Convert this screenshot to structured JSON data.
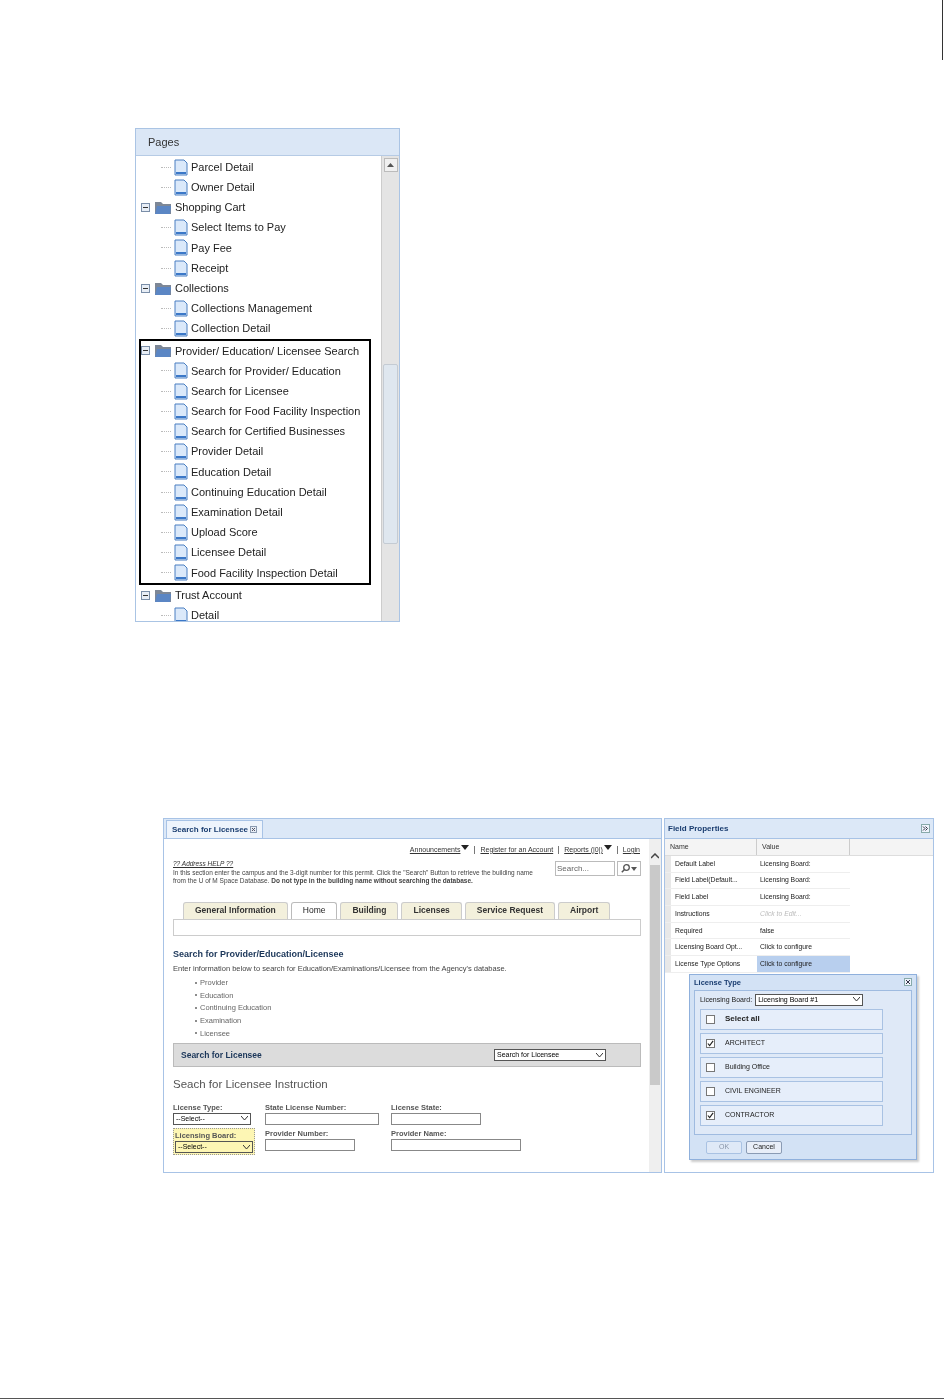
{
  "pages_panel": {
    "title": "Pages",
    "tree": [
      {
        "kind": "page",
        "label": "Parcel Detail"
      },
      {
        "kind": "page",
        "label": "Owner Detail"
      },
      {
        "kind": "folder",
        "label": "Shopping Cart",
        "expanded": true,
        "outlined": false,
        "children": [
          {
            "kind": "page",
            "label": "Select Items to Pay"
          },
          {
            "kind": "page",
            "label": "Pay Fee"
          },
          {
            "kind": "page",
            "label": "Receipt"
          }
        ]
      },
      {
        "kind": "folder",
        "label": "Collections",
        "expanded": true,
        "outlined": false,
        "children": [
          {
            "kind": "page",
            "label": "Collections Management"
          },
          {
            "kind": "page",
            "label": "Collection Detail"
          }
        ]
      },
      {
        "kind": "folder",
        "label": "Provider/ Education/ Licensee Search",
        "expanded": true,
        "outlined": true,
        "children": [
          {
            "kind": "page",
            "label": "Search for Provider/ Education"
          },
          {
            "kind": "page",
            "label": "Search for Licensee"
          },
          {
            "kind": "page",
            "label": "Search for Food Facility Inspection"
          },
          {
            "kind": "page",
            "label": "Search for Certified Businesses"
          },
          {
            "kind": "page",
            "label": "Provider Detail"
          },
          {
            "kind": "page",
            "label": "Education Detail"
          },
          {
            "kind": "page",
            "label": "Continuing Education Detail"
          },
          {
            "kind": "page",
            "label": "Examination Detail"
          },
          {
            "kind": "page",
            "label": "Upload Score"
          },
          {
            "kind": "page",
            "label": "Licensee Detail"
          },
          {
            "kind": "page",
            "label": "Food Facility Inspection Detail"
          }
        ]
      },
      {
        "kind": "folder",
        "label": "Trust Account",
        "expanded": true,
        "outlined": false,
        "children": [
          {
            "kind": "page",
            "label": "Detail"
          }
        ]
      }
    ]
  },
  "editor": {
    "tab": {
      "label": "Search for Licensee"
    },
    "top_links": [
      {
        "label": "Announcements",
        "kind": "menu"
      },
      {
        "label": "Register for an Account",
        "kind": "link"
      },
      {
        "label": "Reports (|0|)",
        "kind": "menu"
      },
      {
        "label": "Login",
        "kind": "link"
      }
    ],
    "help_title": "?? Address HELP ??",
    "help_text": "In this section enter the campus and the 3-digit number for this permit.  Click the \"Search\" Button to retrieve the building name from the U of M Space Database.  **Do not type in the building name without searching the database.**",
    "search": {
      "placeholder": "Search..."
    },
    "nav_tabs": [
      {
        "label": "General Information",
        "selected": false
      },
      {
        "label": "Home",
        "selected": true
      },
      {
        "label": "Building",
        "selected": false
      },
      {
        "label": "Licenses",
        "selected": false
      },
      {
        "label": "Service Request",
        "selected": false
      },
      {
        "label": "Airport",
        "selected": false
      }
    ],
    "heading": "Search for Provider/Education/Licensee",
    "intro": "Enter information below to search for Education/Examinations/Licensee from the Agency's database.",
    "bullets": [
      "Provider",
      "Education",
      "Continuing Education",
      "Examination",
      "Licensee"
    ],
    "section": {
      "title": "Search for Licensee",
      "select": "Search for Licensee"
    },
    "instruction": "Seach for Licensee Instruction",
    "fields": [
      {
        "label": "License Type:",
        "kind": "select",
        "value": "--Select--",
        "highlighted": false
      },
      {
        "label": "State License Number:",
        "kind": "text",
        "highlighted": false
      },
      {
        "label": "License State:",
        "kind": "text",
        "highlighted": false
      },
      {
        "label": "Licensing Board:",
        "kind": "select",
        "value": "--Select--",
        "highlighted": true
      },
      {
        "label": "Provider Number:",
        "kind": "text",
        "highlighted": false
      },
      {
        "label": "Provider Name:",
        "kind": "text",
        "highlighted": false
      }
    ]
  },
  "field_properties": {
    "title": "Field Properties",
    "columns": [
      "Name",
      "Value"
    ],
    "rows": [
      {
        "name": "Default Label",
        "value": "Licensing Board:",
        "placeholder": false,
        "selected": false
      },
      {
        "name": "Field Label(Default...",
        "value": "Licensing Board:",
        "placeholder": false,
        "selected": false
      },
      {
        "name": "Field Label",
        "value": "Licensing Board:",
        "placeholder": false,
        "selected": false
      },
      {
        "name": "Instructions",
        "value": "Click to Edit...",
        "placeholder": true,
        "selected": false
      },
      {
        "name": "Required",
        "value": "false",
        "placeholder": false,
        "selected": false
      },
      {
        "name": "Licensing Board Opt...",
        "value": "Click to configure",
        "placeholder": false,
        "selected": false
      },
      {
        "name": "License Type Options",
        "value": "Click to configure",
        "placeholder": false,
        "selected": true
      }
    ]
  },
  "dialog": {
    "title": "License Type",
    "board_label": "Licensing Board:",
    "board_value": "Licensing Board #1",
    "options": [
      {
        "label": "Select all",
        "checked": false,
        "bold": true
      },
      {
        "label": "ARCHITECT",
        "checked": true,
        "bold": false
      },
      {
        "label": "Building Office",
        "checked": false,
        "bold": false
      },
      {
        "label": "CIVIL ENGINEER",
        "checked": false,
        "bold": false
      },
      {
        "label": "CONTRACTOR",
        "checked": true,
        "bold": false
      }
    ],
    "buttons": [
      {
        "label": "OK",
        "disabled": true
      },
      {
        "label": "Cancel",
        "disabled": false
      }
    ]
  }
}
